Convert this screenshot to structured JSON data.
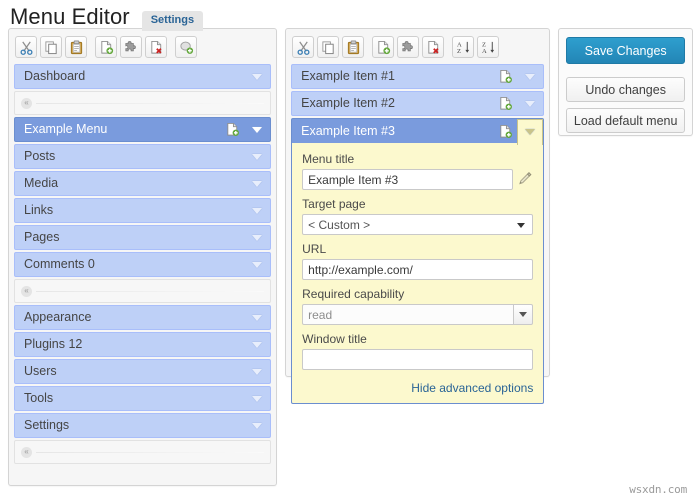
{
  "header": {
    "title": "Menu Editor",
    "tab_settings": "Settings"
  },
  "left_panel": {
    "toolbar": [
      {
        "name": "cut-icon",
        "title": "Cut"
      },
      {
        "name": "copy-icon",
        "title": "Copy"
      },
      {
        "name": "paste-icon",
        "title": "Paste"
      },
      {
        "name": "new-menu-icon",
        "title": "New menu"
      },
      {
        "name": "puzzle-icon",
        "title": "Show/hide"
      },
      {
        "name": "delete-menu-icon",
        "title": "Delete menu"
      },
      {
        "name": "new-separator-icon",
        "title": "New separator"
      }
    ],
    "items": [
      {
        "label": "Dashboard",
        "type": "item",
        "selected": false,
        "has_page_icon": false
      },
      {
        "label": "",
        "type": "separator",
        "selected": false,
        "has_page_icon": false
      },
      {
        "label": "Example Menu",
        "type": "item",
        "selected": true,
        "has_page_icon": true
      },
      {
        "label": "Posts",
        "type": "item",
        "selected": false,
        "has_page_icon": false
      },
      {
        "label": "Media",
        "type": "item",
        "selected": false,
        "has_page_icon": false
      },
      {
        "label": "Links",
        "type": "item",
        "selected": false,
        "has_page_icon": false
      },
      {
        "label": "Pages",
        "type": "item",
        "selected": false,
        "has_page_icon": false
      },
      {
        "label": "Comments 0",
        "type": "item",
        "selected": false,
        "has_page_icon": false
      },
      {
        "label": "",
        "type": "separator",
        "selected": false,
        "has_page_icon": false
      },
      {
        "label": "Appearance",
        "type": "item",
        "selected": false,
        "has_page_icon": false
      },
      {
        "label": "Plugins 12",
        "type": "item",
        "selected": false,
        "has_page_icon": false
      },
      {
        "label": "Users",
        "type": "item",
        "selected": false,
        "has_page_icon": false
      },
      {
        "label": "Tools",
        "type": "item",
        "selected": false,
        "has_page_icon": false
      },
      {
        "label": "Settings",
        "type": "item",
        "selected": false,
        "has_page_icon": false
      },
      {
        "label": "",
        "type": "separator",
        "selected": false,
        "has_page_icon": false
      }
    ],
    "separator_glyph": "«"
  },
  "mid_panel": {
    "toolbar": [
      {
        "name": "cut-icon",
        "title": "Cut"
      },
      {
        "name": "copy-icon",
        "title": "Copy"
      },
      {
        "name": "paste-icon",
        "title": "Paste"
      },
      {
        "name": "new-item-icon",
        "title": "New item"
      },
      {
        "name": "puzzle-icon",
        "title": "Show/hide"
      },
      {
        "name": "delete-item-icon",
        "title": "Delete item"
      },
      {
        "name": "sort-asc-icon",
        "title": "Sort ascending"
      },
      {
        "name": "sort-desc-icon",
        "title": "Sort descending"
      }
    ],
    "items": [
      {
        "label": "Example Item #1",
        "selected": false,
        "expanded": false
      },
      {
        "label": "Example Item #2",
        "selected": false,
        "expanded": false
      },
      {
        "label": "Example Item #3",
        "selected": true,
        "expanded": true
      }
    ],
    "form": {
      "menu_title_label": "Menu title",
      "menu_title_value": "Example Item #3",
      "edit_icon": "pencil-icon",
      "target_page_label": "Target page",
      "target_page_value": "< Custom >",
      "url_label": "URL",
      "url_value": "http://example.com/",
      "capability_label": "Required capability",
      "capability_value": "read",
      "window_title_label": "Window title",
      "window_title_value": "",
      "advanced_link": "Hide advanced options"
    }
  },
  "right_panel": {
    "save_label": "Save Changes",
    "undo_label": "Undo changes",
    "load_default_label": "Load default menu"
  },
  "watermark": "wsxdn.com",
  "colors": {
    "row_normal_bg": "#bed0f7",
    "row_selected_bg": "#7a9bdd",
    "form_bg": "#fcf9ce",
    "primary_button": "#2386b6",
    "link": "#2a6496"
  }
}
